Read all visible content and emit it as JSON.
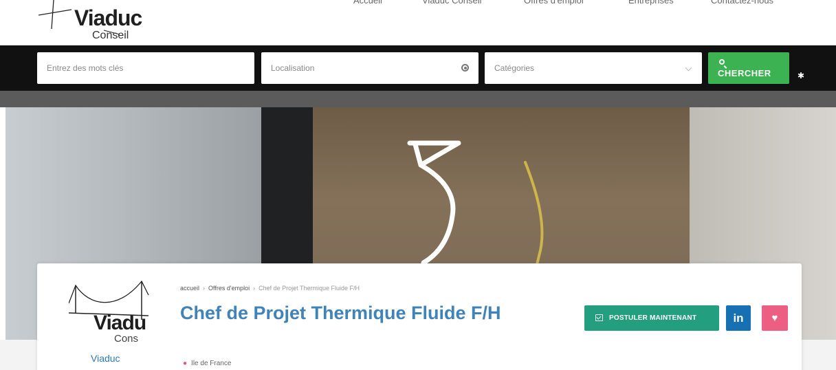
{
  "header": {
    "logo_word": "Viaduc",
    "logo_sub": "Conseil",
    "nav": [
      {
        "label": "Accueil"
      },
      {
        "label": "Viaduc Conseil"
      },
      {
        "label": "Offres d'emploi"
      },
      {
        "label": "Entreprises"
      },
      {
        "label": "Contactez-nous"
      }
    ]
  },
  "search": {
    "keywords_placeholder": "Entrez des mots clés",
    "location_placeholder": "Localisation",
    "category_label": "Catégories",
    "button_label": "CHERCHER"
  },
  "job": {
    "breadcrumb": [
      "accueil",
      "Offres d'emploi",
      "Chef de Projet Thermique Fluide F/H"
    ],
    "title": "Chef de Projet Thermique Fluide F/H",
    "location": "Ile de France",
    "company_logo_word": "Viadu",
    "company_logo_sub": "Cons",
    "company_name": "Viaduc",
    "apply_label": "POSTULER MAINTENANT",
    "linkedin_label": "in"
  },
  "colors": {
    "search_button": "#3cb253",
    "apply_button": "#239f7f",
    "linkedin": "#1670b1",
    "favorite": "#ec5f82",
    "title": "#3f83b8"
  }
}
